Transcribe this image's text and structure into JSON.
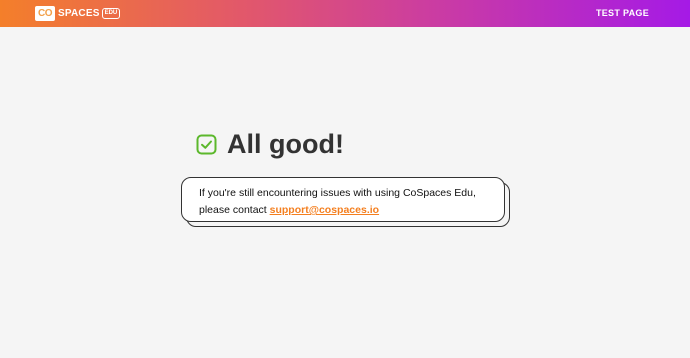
{
  "header": {
    "logo_mark": "CO",
    "logo_text": "SPACES",
    "logo_badge": "EDU",
    "test_page_label": "TEST PAGE"
  },
  "main": {
    "heading": "All good!",
    "message_line1": "If you're still encountering issues with using CoSpaces Edu,",
    "message_line2_prefix": "please contact ",
    "support_link": "support@cospaces.io",
    "check_color": "#5cb82c"
  }
}
